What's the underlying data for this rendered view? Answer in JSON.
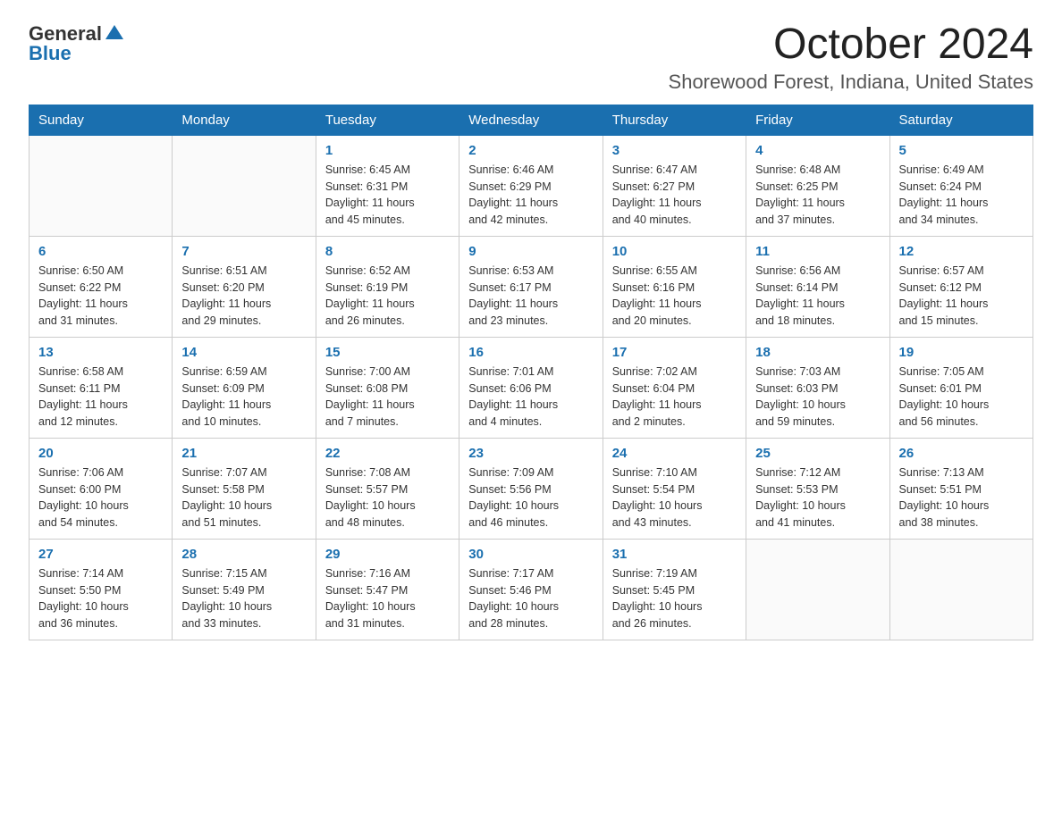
{
  "header": {
    "logo_general": "General",
    "logo_blue": "Blue",
    "title": "October 2024",
    "subtitle": "Shorewood Forest, Indiana, United States"
  },
  "calendar": {
    "weekdays": [
      "Sunday",
      "Monday",
      "Tuesday",
      "Wednesday",
      "Thursday",
      "Friday",
      "Saturday"
    ],
    "weeks": [
      [
        {
          "day": "",
          "info": ""
        },
        {
          "day": "",
          "info": ""
        },
        {
          "day": "1",
          "info": "Sunrise: 6:45 AM\nSunset: 6:31 PM\nDaylight: 11 hours\nand 45 minutes."
        },
        {
          "day": "2",
          "info": "Sunrise: 6:46 AM\nSunset: 6:29 PM\nDaylight: 11 hours\nand 42 minutes."
        },
        {
          "day": "3",
          "info": "Sunrise: 6:47 AM\nSunset: 6:27 PM\nDaylight: 11 hours\nand 40 minutes."
        },
        {
          "day": "4",
          "info": "Sunrise: 6:48 AM\nSunset: 6:25 PM\nDaylight: 11 hours\nand 37 minutes."
        },
        {
          "day": "5",
          "info": "Sunrise: 6:49 AM\nSunset: 6:24 PM\nDaylight: 11 hours\nand 34 minutes."
        }
      ],
      [
        {
          "day": "6",
          "info": "Sunrise: 6:50 AM\nSunset: 6:22 PM\nDaylight: 11 hours\nand 31 minutes."
        },
        {
          "day": "7",
          "info": "Sunrise: 6:51 AM\nSunset: 6:20 PM\nDaylight: 11 hours\nand 29 minutes."
        },
        {
          "day": "8",
          "info": "Sunrise: 6:52 AM\nSunset: 6:19 PM\nDaylight: 11 hours\nand 26 minutes."
        },
        {
          "day": "9",
          "info": "Sunrise: 6:53 AM\nSunset: 6:17 PM\nDaylight: 11 hours\nand 23 minutes."
        },
        {
          "day": "10",
          "info": "Sunrise: 6:55 AM\nSunset: 6:16 PM\nDaylight: 11 hours\nand 20 minutes."
        },
        {
          "day": "11",
          "info": "Sunrise: 6:56 AM\nSunset: 6:14 PM\nDaylight: 11 hours\nand 18 minutes."
        },
        {
          "day": "12",
          "info": "Sunrise: 6:57 AM\nSunset: 6:12 PM\nDaylight: 11 hours\nand 15 minutes."
        }
      ],
      [
        {
          "day": "13",
          "info": "Sunrise: 6:58 AM\nSunset: 6:11 PM\nDaylight: 11 hours\nand 12 minutes."
        },
        {
          "day": "14",
          "info": "Sunrise: 6:59 AM\nSunset: 6:09 PM\nDaylight: 11 hours\nand 10 minutes."
        },
        {
          "day": "15",
          "info": "Sunrise: 7:00 AM\nSunset: 6:08 PM\nDaylight: 11 hours\nand 7 minutes."
        },
        {
          "day": "16",
          "info": "Sunrise: 7:01 AM\nSunset: 6:06 PM\nDaylight: 11 hours\nand 4 minutes."
        },
        {
          "day": "17",
          "info": "Sunrise: 7:02 AM\nSunset: 6:04 PM\nDaylight: 11 hours\nand 2 minutes."
        },
        {
          "day": "18",
          "info": "Sunrise: 7:03 AM\nSunset: 6:03 PM\nDaylight: 10 hours\nand 59 minutes."
        },
        {
          "day": "19",
          "info": "Sunrise: 7:05 AM\nSunset: 6:01 PM\nDaylight: 10 hours\nand 56 minutes."
        }
      ],
      [
        {
          "day": "20",
          "info": "Sunrise: 7:06 AM\nSunset: 6:00 PM\nDaylight: 10 hours\nand 54 minutes."
        },
        {
          "day": "21",
          "info": "Sunrise: 7:07 AM\nSunset: 5:58 PM\nDaylight: 10 hours\nand 51 minutes."
        },
        {
          "day": "22",
          "info": "Sunrise: 7:08 AM\nSunset: 5:57 PM\nDaylight: 10 hours\nand 48 minutes."
        },
        {
          "day": "23",
          "info": "Sunrise: 7:09 AM\nSunset: 5:56 PM\nDaylight: 10 hours\nand 46 minutes."
        },
        {
          "day": "24",
          "info": "Sunrise: 7:10 AM\nSunset: 5:54 PM\nDaylight: 10 hours\nand 43 minutes."
        },
        {
          "day": "25",
          "info": "Sunrise: 7:12 AM\nSunset: 5:53 PM\nDaylight: 10 hours\nand 41 minutes."
        },
        {
          "day": "26",
          "info": "Sunrise: 7:13 AM\nSunset: 5:51 PM\nDaylight: 10 hours\nand 38 minutes."
        }
      ],
      [
        {
          "day": "27",
          "info": "Sunrise: 7:14 AM\nSunset: 5:50 PM\nDaylight: 10 hours\nand 36 minutes."
        },
        {
          "day": "28",
          "info": "Sunrise: 7:15 AM\nSunset: 5:49 PM\nDaylight: 10 hours\nand 33 minutes."
        },
        {
          "day": "29",
          "info": "Sunrise: 7:16 AM\nSunset: 5:47 PM\nDaylight: 10 hours\nand 31 minutes."
        },
        {
          "day": "30",
          "info": "Sunrise: 7:17 AM\nSunset: 5:46 PM\nDaylight: 10 hours\nand 28 minutes."
        },
        {
          "day": "31",
          "info": "Sunrise: 7:19 AM\nSunset: 5:45 PM\nDaylight: 10 hours\nand 26 minutes."
        },
        {
          "day": "",
          "info": ""
        },
        {
          "day": "",
          "info": ""
        }
      ]
    ]
  }
}
